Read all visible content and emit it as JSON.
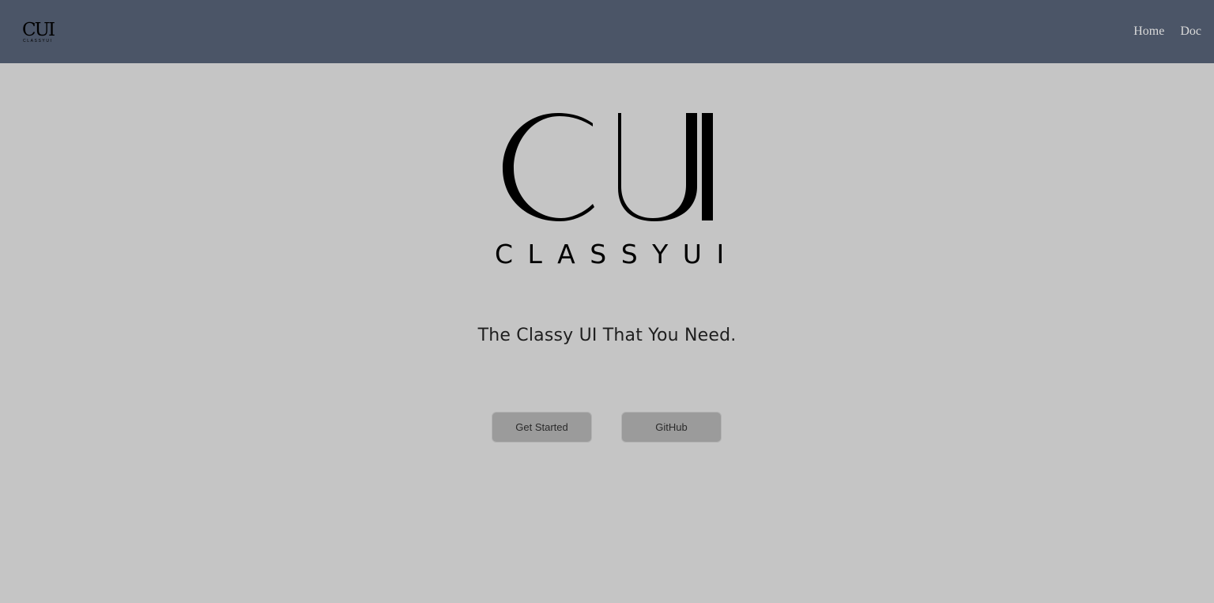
{
  "navbar": {
    "logo": {
      "mark": "CUI",
      "wordmark": "CLASSYUI"
    },
    "links": [
      {
        "label": "Home"
      },
      {
        "label": "Doc"
      }
    ]
  },
  "hero": {
    "logo": {
      "mark": "CUI",
      "wordmark": "CLASSYUI"
    },
    "tagline": "The Classy UI That You Need.",
    "buttons": {
      "get_started": "Get Started",
      "github": "GitHub"
    }
  },
  "colors": {
    "navbar_bg": "#4b5567",
    "page_bg": "#c5c5c5",
    "button_bg": "#9b9b9b",
    "nav_link": "#d9d9d9"
  }
}
